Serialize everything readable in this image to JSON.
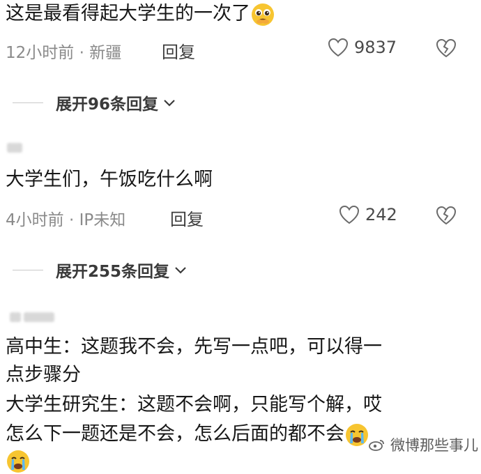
{
  "comments": [
    {
      "text": "这是最看得起大学生的一次了",
      "emoji": "pleading-face-emoji",
      "meta": "12小时前 · 新疆",
      "reply_label": "回复",
      "likes": "9837",
      "expand_label": "展开96条回复"
    },
    {
      "text": "大学生们，午饭吃什么啊",
      "meta": "4小时前 · IP未知",
      "reply_label": "回复",
      "likes": "242",
      "expand_label": "展开255条回复"
    },
    {
      "lines": [
        "高中生：这题我不会，先写一点吧，可以得一",
        "点步骤分",
        "大学生研究生：这题不会啊，只能写个解，哎",
        "怎么下一题还是不会，怎么后面的都不会"
      ],
      "emoji": "crying-face-emoji"
    }
  ],
  "watermark": {
    "text": "微博那些事儿",
    "icon": "weibo-icon"
  },
  "colors": {
    "meta_gray": "#8a8a8a",
    "text": "#171717",
    "divider": "#c9c9c9",
    "emoji_yellow": "#f7c531"
  }
}
